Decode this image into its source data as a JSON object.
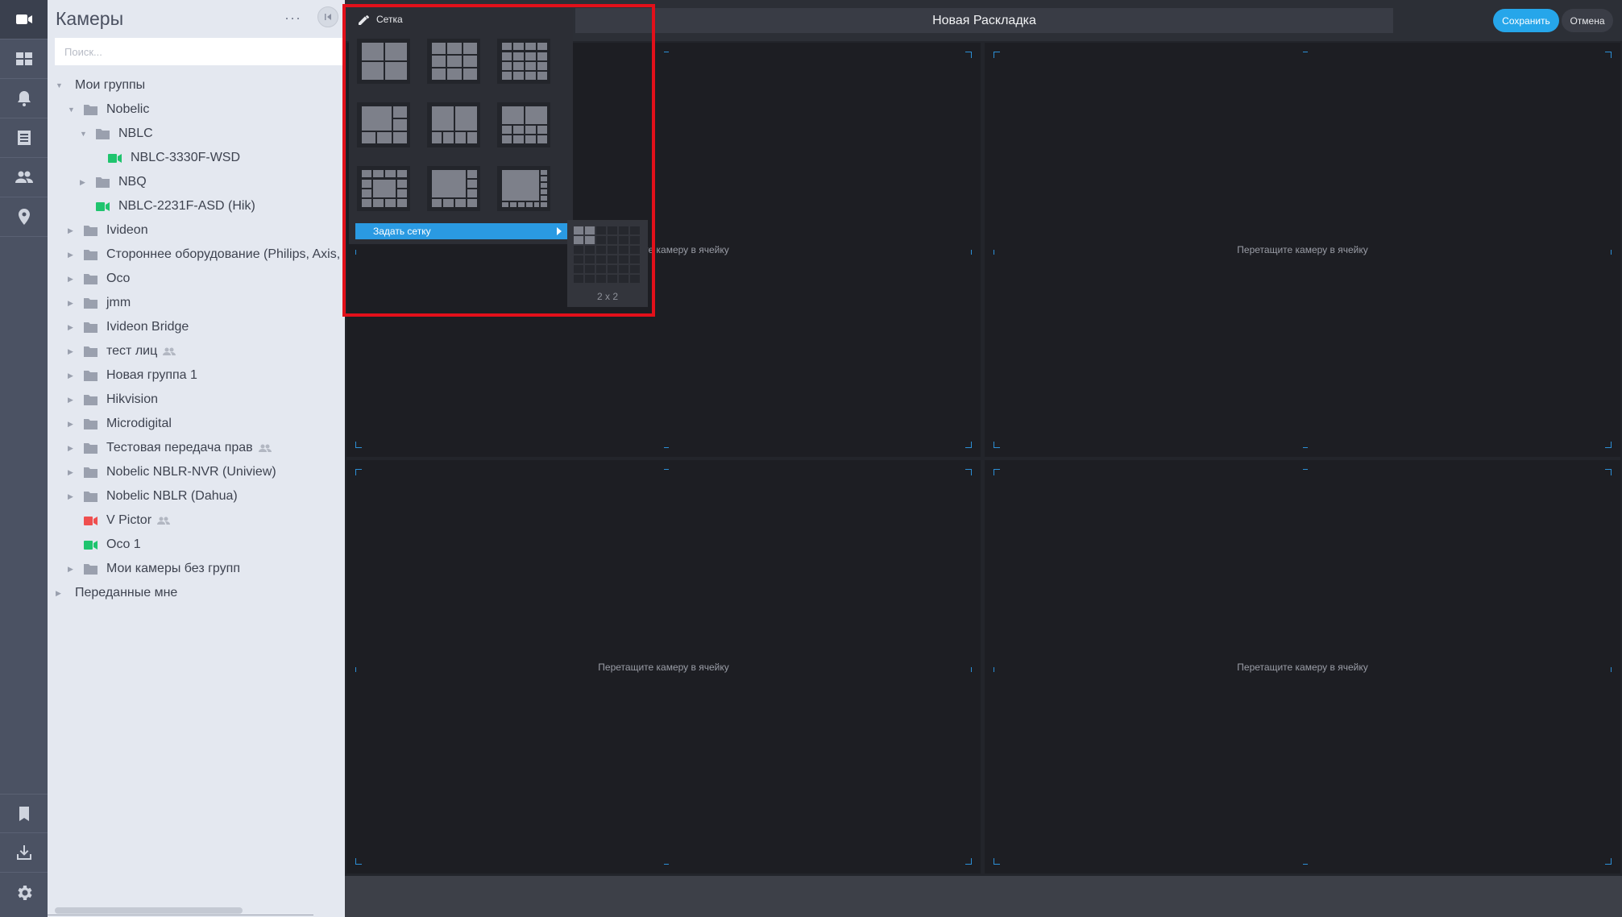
{
  "rail": {
    "top_icons": [
      "camera-icon",
      "layouts-icon",
      "bell-icon",
      "archive-icon",
      "users-icon",
      "map-pin-icon"
    ],
    "bottom_icons": [
      "bookmark-icon",
      "download-icon",
      "settings-icon"
    ]
  },
  "panel": {
    "title": "Камеры",
    "more_label": "···",
    "search_placeholder": "Поиск..."
  },
  "tree": [
    {
      "label": "Мои группы",
      "type": "group",
      "expanded": true
    },
    {
      "label": "Nobelic",
      "type": "folder",
      "expanded": true
    },
    {
      "label": "NBLC",
      "type": "folder",
      "expanded": true
    },
    {
      "label": "NBLC-3330F-WSD",
      "type": "camera",
      "status": "online"
    },
    {
      "label": "NBQ",
      "type": "folder",
      "expanded": false
    },
    {
      "label": "NBLC-2231F-ASD (Hik)",
      "type": "camera",
      "status": "online"
    },
    {
      "label": "Ivideon",
      "type": "folder"
    },
    {
      "label": "Стороннее оборудование (Philips, Axis,",
      "type": "folder"
    },
    {
      "label": "Oco",
      "type": "folder"
    },
    {
      "label": "jmm",
      "type": "folder"
    },
    {
      "label": "Ivideon Bridge",
      "type": "folder"
    },
    {
      "label": "тест лиц",
      "type": "folder",
      "shared": true
    },
    {
      "label": "Новая группа 1",
      "type": "folder"
    },
    {
      "label": "Hikvision",
      "type": "folder"
    },
    {
      "label": "Microdigital",
      "type": "folder"
    },
    {
      "label": "Тестовая передача прав",
      "type": "folder",
      "shared": true
    },
    {
      "label": "Nobelic NBLR-NVR (Uniview)",
      "type": "folder"
    },
    {
      "label": "Nobelic NBLR (Dahua)",
      "type": "folder"
    },
    {
      "label": "V Pictor",
      "type": "camera",
      "status": "offline",
      "shared": true
    },
    {
      "label": "Oco 1",
      "type": "camera",
      "status": "online"
    },
    {
      "label": "Мои камеры без групп",
      "type": "folder"
    },
    {
      "label": "Переданные мне",
      "type": "group",
      "expanded": false
    }
  ],
  "header": {
    "layout_title": "Новая Раскладка",
    "save_label": "Сохранить",
    "cancel_label": "Отмена"
  },
  "grid": {
    "cell_hint": "Перетащите камеру в ячейку"
  },
  "popup": {
    "title": "Сетка",
    "set_grid_label": "Задать сетку",
    "custom_grid_size": "2 x 2",
    "layout_presets": [
      "2x2",
      "3x3",
      "4x3",
      "1+5",
      "2+4",
      "2+8",
      "1+12",
      "1+7",
      "1+11"
    ]
  },
  "colors": {
    "accent": "#26a6ea",
    "online": "#1fc46e",
    "offline": "#ef4f4f",
    "highlight": "#e2101a"
  }
}
